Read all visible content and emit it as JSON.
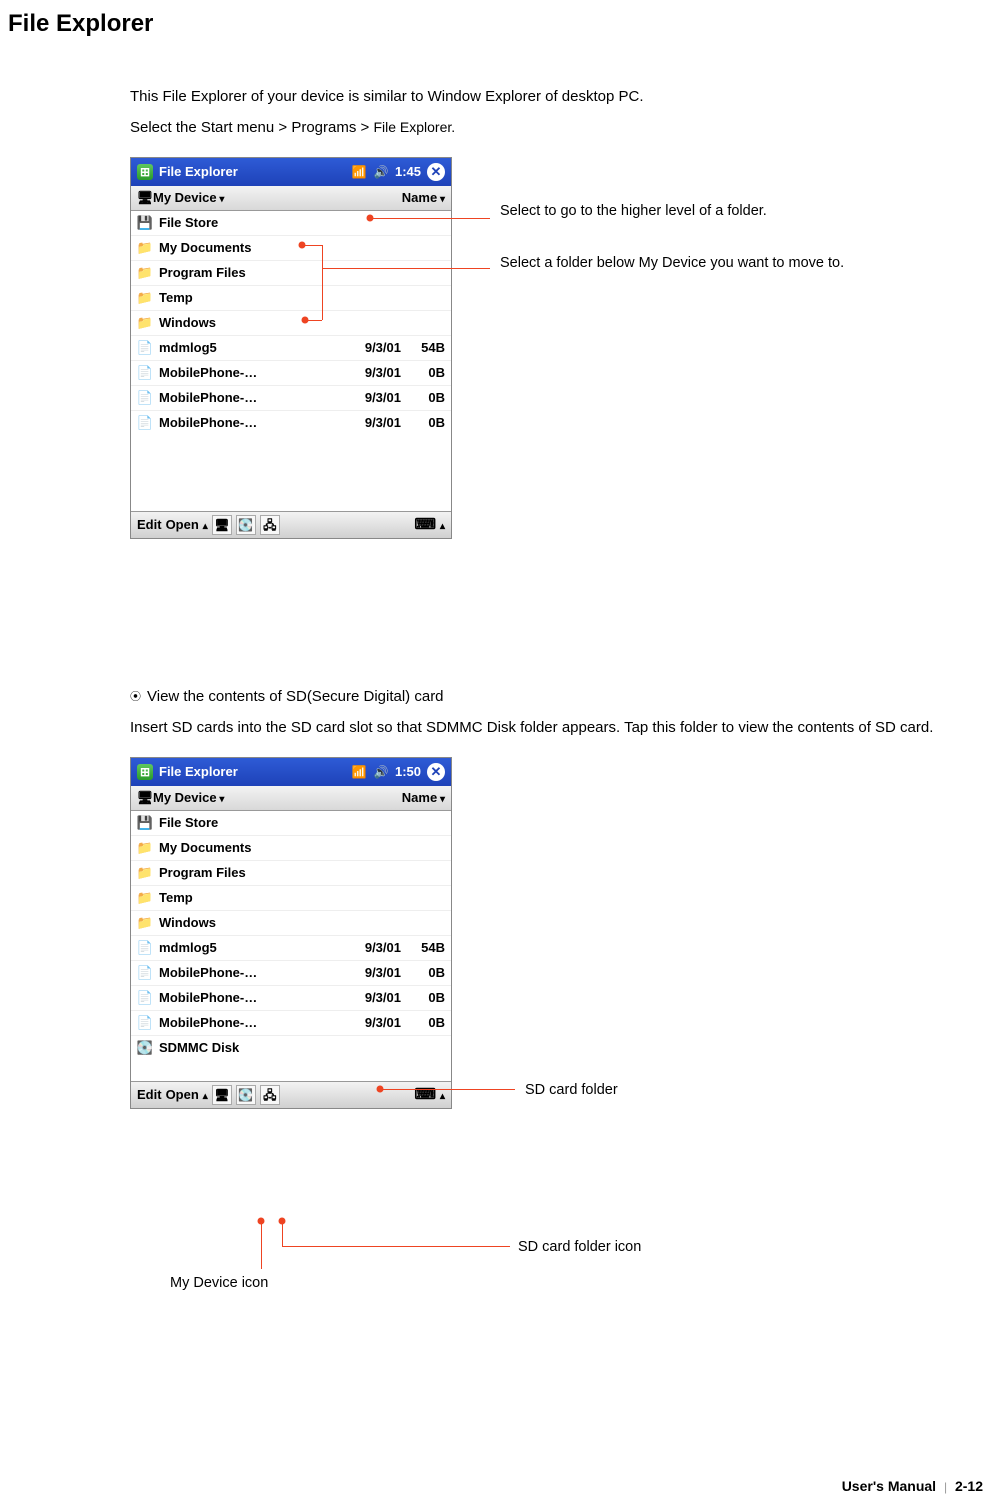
{
  "page": {
    "title": "File Explorer",
    "intro1": "This File Explorer of your device is similar to Window Explorer of desktop PC.",
    "intro2_a": "Select the Start menu > Programs > ",
    "intro2_b": "File Explorer."
  },
  "screenshot1": {
    "titlebar": {
      "app": "File Explorer",
      "time": "1:45"
    },
    "navbar": {
      "location": "My Device",
      "sort": "Name"
    },
    "rows": [
      {
        "kind": "drive",
        "name": "File Store"
      },
      {
        "kind": "folder",
        "name": "My Documents"
      },
      {
        "kind": "folder",
        "name": "Program Files"
      },
      {
        "kind": "folder",
        "name": "Temp"
      },
      {
        "kind": "folder",
        "name": "Windows"
      },
      {
        "kind": "doc",
        "name": "mdmlog5",
        "date": "9/3/01",
        "size": "54B"
      },
      {
        "kind": "doc",
        "name": "MobilePhone-…",
        "date": "9/3/01",
        "size": "0B"
      },
      {
        "kind": "doc",
        "name": "MobilePhone-…",
        "date": "9/3/01",
        "size": "0B"
      },
      {
        "kind": "doc",
        "name": "MobilePhone-…",
        "date": "9/3/01",
        "size": "0B"
      }
    ],
    "bottombar": {
      "edit": "Edit",
      "open": "Open"
    }
  },
  "annotations1": {
    "higher": "Select to go to the higher level of a folder.",
    "moveto": "Select a folder below My Device you want to move to."
  },
  "sd": {
    "heading": "View the contents of SD(Secure Digital) card",
    "body": "Insert SD cards into the SD card slot so that SDMMC Disk folder appears. Tap this folder to view the contents of SD card."
  },
  "screenshot2": {
    "titlebar": {
      "app": "File Explorer",
      "time": "1:50"
    },
    "navbar": {
      "location": "My Device",
      "sort": "Name"
    },
    "rows": [
      {
        "kind": "drive",
        "name": "File Store"
      },
      {
        "kind": "folder",
        "name": "My Documents"
      },
      {
        "kind": "folder",
        "name": "Program Files"
      },
      {
        "kind": "folder",
        "name": "Temp"
      },
      {
        "kind": "folder",
        "name": "Windows"
      },
      {
        "kind": "doc",
        "name": "mdmlog5",
        "date": "9/3/01",
        "size": "54B"
      },
      {
        "kind": "doc",
        "name": "MobilePhone-…",
        "date": "9/3/01",
        "size": "0B"
      },
      {
        "kind": "doc",
        "name": "MobilePhone-…",
        "date": "9/3/01",
        "size": "0B"
      },
      {
        "kind": "doc",
        "name": "MobilePhone-…",
        "date": "9/3/01",
        "size": "0B"
      },
      {
        "kind": "sd",
        "name": "SDMMC Disk"
      }
    ],
    "bottombar": {
      "edit": "Edit",
      "open": "Open"
    }
  },
  "annotations2": {
    "sd_folder": "SD card folder",
    "sd_icon": "SD card folder icon",
    "device_icon": "My Device icon"
  },
  "footer": {
    "manual": "User's Manual",
    "page": "2-12"
  }
}
